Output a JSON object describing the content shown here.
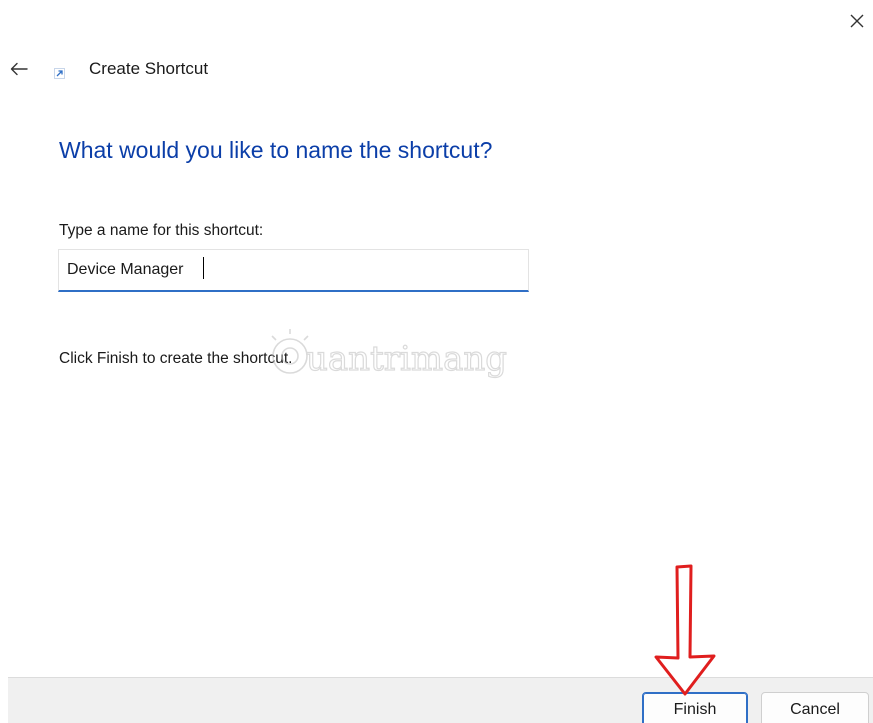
{
  "window": {
    "title": "Create Shortcut",
    "close_icon": "close-icon",
    "back_icon": "back-arrow-icon",
    "app_icon": "shortcut-arrow-icon"
  },
  "page": {
    "heading": "What would you like to name the shortcut?",
    "name_label": "Type a name for this shortcut:",
    "name_value": "Device Manager",
    "instruction": "Click Finish to create the shortcut."
  },
  "watermark": {
    "text": "uantrimang"
  },
  "footer": {
    "finish_label": "Finish",
    "cancel_label": "Cancel"
  },
  "annotation": {
    "icon": "red-arrow-down-icon",
    "color": "#e01e1e"
  },
  "colors": {
    "heading": "#0b3ea8",
    "accent": "#2f6fc6",
    "footer_bg": "#f0f0f0"
  }
}
